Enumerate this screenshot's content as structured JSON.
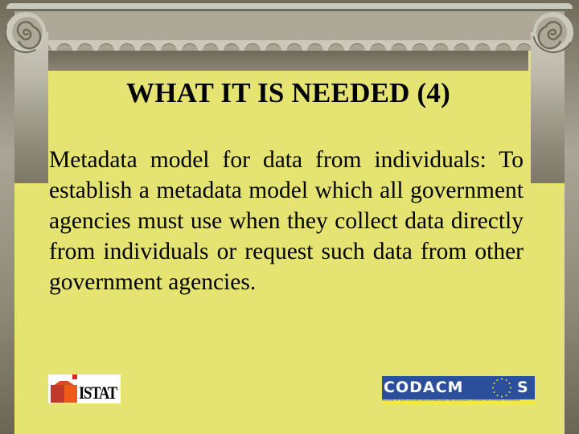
{
  "slide": {
    "title": "WHAT IT IS NEEDED (4)",
    "body": "Metadata model for data from individuals: To establish a metadata model which all government agencies must use when they collect data directly from individuals or request such data from other government agencies."
  },
  "logos": {
    "istat": {
      "text": "ISTAT",
      "icon": "istat-house-icon"
    },
    "codacmos": {
      "text_main": "CODACM",
      "text_end": "S",
      "icon": "eu-stars-icon",
      "subtitle": "CLUSTER OF DATA COLLECTION INTEGRATION AND METADATA SYSTEMS FOR OFFICIAL STATISTICS"
    }
  },
  "colors": {
    "slide_background": "#e5e472",
    "frame": "#716b5c",
    "column_light": "#cbc8bc",
    "codacmos_blue": "#2c4f9b",
    "codacmos_yellow": "#f0ea3a"
  }
}
